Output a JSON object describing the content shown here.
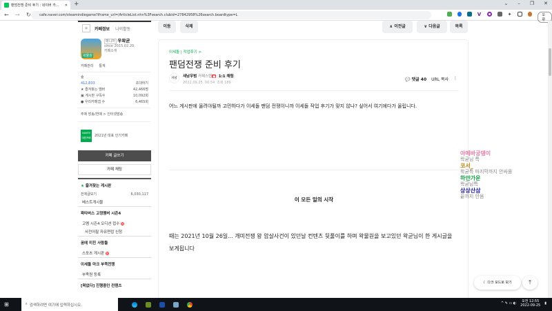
{
  "browser": {
    "tab_title": "팬덤전쟁 준비 후기 : 네이버 카…",
    "url": "cafe.naver.com/steamindiegame?iframe_url=/ArticleList.nhn%3Fsearch.clubid=27842958%26search.boardtype=L",
    "profile_label": "오류"
  },
  "sidebar": {
    "tab_info": "카페정보",
    "tab_activity": "나의활동",
    "cafe_tag": "매니저",
    "cafe_name": "우왁굳",
    "since": "since 2015.02.20.",
    "intro": "카페소개",
    "manage": "카페관리",
    "stats": "통계",
    "level": "숲",
    "members": "412,833",
    "invite": "초대하기",
    "stats_rows": [
      {
        "label": "즐겨찾는 멤버",
        "value": "42,466명"
      },
      {
        "label": "게시판 구독수",
        "value": "10,092회"
      },
      {
        "label": "우리카페앱 수",
        "value": "6,465회"
      }
    ],
    "topic": "주제  방송/연예 > 인터넷방송",
    "award_badge": "NAVER 대표카페",
    "award": "2021년 대표 인기카페",
    "write": "카페 글쓰기",
    "chat": "카페 채팅",
    "fav_boards": "즐겨찾는 게시판",
    "all_posts": "전체글보기",
    "all_count": "6,030,117",
    "best": "베스트게시물",
    "sec1": "왁타버스 고정멤버 시즌4",
    "item1": "고멤 시즌4 오디션 접수",
    "item2": "사전어필 자유면접 신청",
    "sec2": "꿈에 미친 사람들",
    "item3": "스포츠 게시판",
    "sec3": "이세돌 마크 부족전쟁",
    "item4": "부족원 등록",
    "sec4": "[왁없다] 진행중인 컨텐츠"
  },
  "toolbar": {
    "move": "이동",
    "delete": "삭제",
    "prev": "∧ 이전글",
    "next": "∨ 다음글",
    "list": "목록"
  },
  "article": {
    "breadcrumb": "이세돌 | 작업후기 >",
    "title": "팬덤전쟁 준비 후기",
    "avatar": "사냥",
    "author": "새남우범",
    "grade": "카페스텝",
    "chat": "1:1 채팅",
    "date": "2022.09.25. 00:54",
    "views": "조회 189",
    "comments": "댓글 40",
    "url_copy": "URL 복사",
    "body1": "어느 게시판에 올려야될까 고민하다가 이세돌 팬덤 전쟁이니까 이세돌 작업 후기가 맞지 않나? 싶어서 여기에다가 올립니다.",
    "subtitle": "이 모든 일의 시작",
    "body2": "때는 2021년 10월 26일... 개미전쟁 왕 암살사건이 있던날 컨텐츠 뒷풀이를 하며 왁물원을 보고있던 왁굳님이 한 게시글을 보게됩니다"
  },
  "chat_overlay": [
    {
      "name": "아메바궁뎅이",
      "msg": "왁굳님 특",
      "color": "#e87ca8"
    },
    {
      "name": "코서_",
      "msg": "왁굳특 마지막까지 안싸움",
      "color": "#b8860b"
    },
    {
      "name": "하얀가운",
      "msg": "왁굳님특",
      "color": "#1aa34a"
    },
    {
      "name": "상상산삼",
      "msg": "끝까지 안옴",
      "color": "#1a1aa0"
    }
  ],
  "floating": {
    "dark_mode": "다크 모드로 보기",
    "top": "⤒"
  },
  "taskbar": {
    "search": "검색하려면 여기에 입력하십시오.",
    "time": "오전 12:55",
    "date": "2022-09-25"
  }
}
